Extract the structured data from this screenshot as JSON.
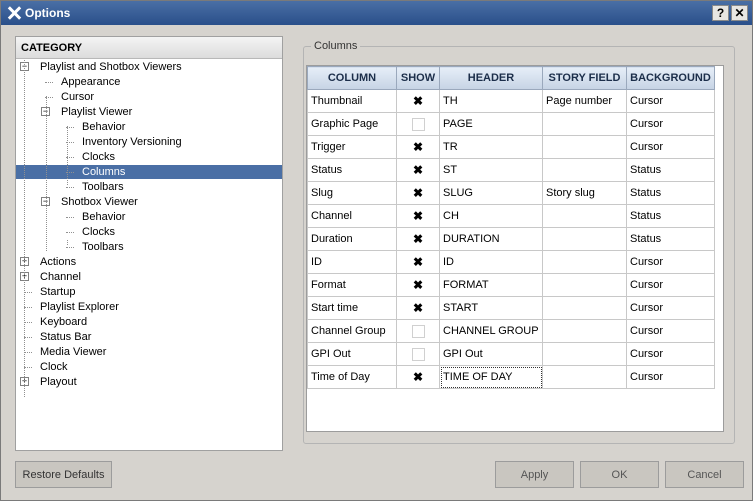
{
  "window": {
    "title": "Options",
    "help_label": "?",
    "close_label": "✕"
  },
  "category": {
    "header": "CATEGORY",
    "items": [
      {
        "label": "Playlist and Shotbox Viewers",
        "expander": "−"
      },
      {
        "label": "Appearance"
      },
      {
        "label": "Cursor"
      },
      {
        "label": "Playlist Viewer",
        "expander": "−"
      },
      {
        "label": "Behavior"
      },
      {
        "label": "Inventory Versioning"
      },
      {
        "label": "Clocks"
      },
      {
        "label": "Columns",
        "selected": true
      },
      {
        "label": "Toolbars"
      },
      {
        "label": "Shotbox Viewer",
        "expander": "−"
      },
      {
        "label": "Behavior"
      },
      {
        "label": "Clocks"
      },
      {
        "label": "Toolbars"
      },
      {
        "label": "Actions",
        "expander": "+"
      },
      {
        "label": "Channel",
        "expander": "+"
      },
      {
        "label": "Startup"
      },
      {
        "label": "Playlist Explorer"
      },
      {
        "label": "Keyboard"
      },
      {
        "label": "Status Bar"
      },
      {
        "label": "Media Viewer"
      },
      {
        "label": "Clock"
      },
      {
        "label": "Playout",
        "expander": "+"
      }
    ]
  },
  "columns_group": {
    "label": "Columns",
    "headers": [
      "COLUMN",
      "SHOW",
      "HEADER",
      "STORY FIELD",
      "BACKGROUND"
    ],
    "rows": [
      {
        "column": "Thumbnail",
        "show": true,
        "header": "TH",
        "story_field": "Page number",
        "background": "Cursor"
      },
      {
        "column": "Graphic Page",
        "show": false,
        "header": "PAGE",
        "story_field": "",
        "background": "Cursor"
      },
      {
        "column": "Trigger",
        "show": true,
        "header": "TR",
        "story_field": "",
        "background": "Cursor"
      },
      {
        "column": "Status",
        "show": true,
        "header": "ST",
        "story_field": "",
        "background": "Status"
      },
      {
        "column": "Slug",
        "show": true,
        "header": "SLUG",
        "story_field": "Story slug",
        "background": "Status"
      },
      {
        "column": "Channel",
        "show": true,
        "header": "CH",
        "story_field": "",
        "background": "Status"
      },
      {
        "column": "Duration",
        "show": true,
        "header": "DURATION",
        "story_field": "",
        "background": "Status"
      },
      {
        "column": "ID",
        "show": true,
        "header": "ID",
        "story_field": "",
        "background": "Cursor"
      },
      {
        "column": "Format",
        "show": true,
        "header": "FORMAT",
        "story_field": "",
        "background": "Cursor"
      },
      {
        "column": "Start time",
        "show": true,
        "header": "START",
        "story_field": "",
        "background": "Cursor"
      },
      {
        "column": "Channel Group",
        "show": false,
        "header": "CHANNEL GROUP",
        "story_field": "",
        "background": "Cursor"
      },
      {
        "column": "GPI Out",
        "show": false,
        "header": "GPI Out",
        "story_field": "",
        "background": "Cursor"
      },
      {
        "column": "Time of Day",
        "show": true,
        "header": "TIME OF DAY",
        "story_field": "",
        "background": "Cursor",
        "header_focused": true
      }
    ],
    "check_glyph": "✖"
  },
  "buttons": {
    "restore": "Restore Defaults",
    "apply": "Apply",
    "ok": "OK",
    "cancel": "Cancel"
  }
}
